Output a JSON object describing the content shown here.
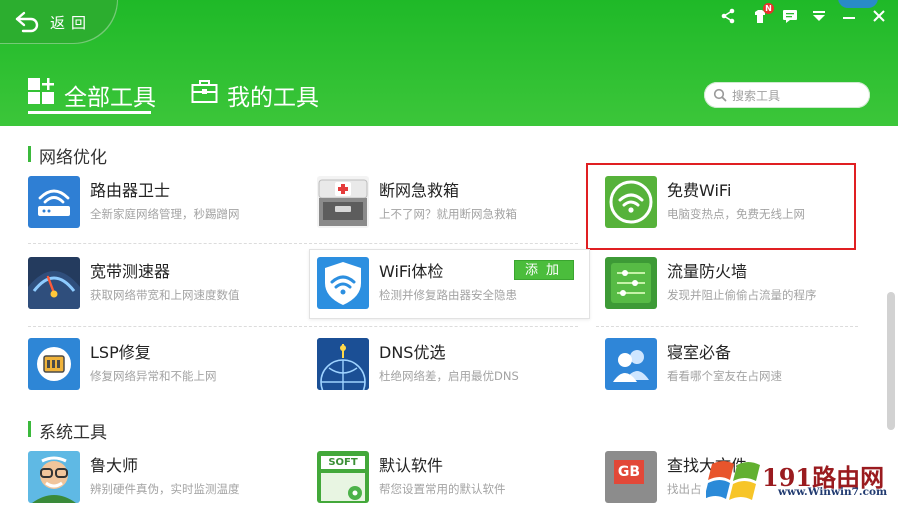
{
  "header": {
    "back_label": "返回",
    "tabs": [
      {
        "label": "全部工具",
        "active": true
      },
      {
        "label": "我的工具",
        "active": false
      }
    ],
    "search": {
      "placeholder": "搜索工具"
    },
    "notification_badge": "N",
    "accent": "#2cb930"
  },
  "sections": [
    {
      "title": "网络优化",
      "tools": [
        {
          "name": "路由器卫士",
          "desc": "全新家庭网络管理，秒踢蹭网",
          "icon": "router-guard-icon"
        },
        {
          "name": "断网急救箱",
          "desc": "上不了网？就用断网急救箱",
          "icon": "first-aid-box-icon"
        },
        {
          "name": "免费WiFi",
          "desc": "电脑变热点，免费无线上网",
          "icon": "free-wifi-icon"
        },
        {
          "name": "宽带测速器",
          "desc": "获取网络带宽和上网速度数值",
          "icon": "speed-gauge-icon"
        },
        {
          "name": "WiFi体检",
          "desc": "检测并修复路由器安全隐患",
          "icon": "wifi-shield-icon",
          "action": "添加"
        },
        {
          "name": "流量防火墙",
          "desc": "发现并阻止偷偷占流量的程序",
          "icon": "traffic-firewall-icon"
        },
        {
          "name": "LSP修复",
          "desc": "修复网络异常和不能上网",
          "icon": "lsp-chip-icon"
        },
        {
          "name": "DNS优选",
          "desc": "杜绝网络差，启用最优DNS",
          "icon": "dns-globe-icon"
        },
        {
          "name": "寝室必备",
          "desc": "看看哪个室友在占网速",
          "icon": "roommates-icon"
        }
      ]
    },
    {
      "title": "系统工具",
      "tools": [
        {
          "name": "鲁大师",
          "desc": "辨别硬件真伪，实时监测温度",
          "icon": "master-lu-icon"
        },
        {
          "name": "默认软件",
          "desc": "帮您设置常用的默认软件",
          "icon": "soft-default-icon",
          "badge": "SOFT"
        },
        {
          "name": "查找大文件",
          "desc": "找出占",
          "icon": "big-file-icon",
          "badge": "GB"
        }
      ]
    }
  ],
  "watermark": {
    "brand": "191路由网",
    "url": "www.Winwin7.com"
  }
}
